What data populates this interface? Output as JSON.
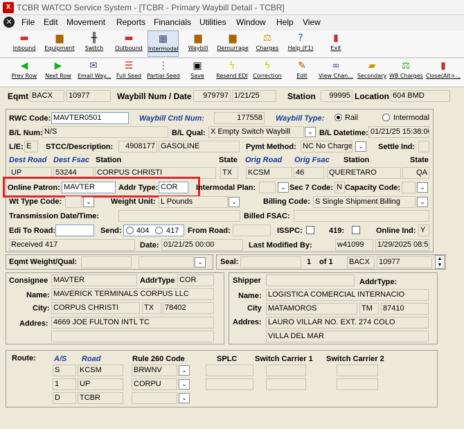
{
  "window": {
    "title": "TCBR WATCO Service System - [TCBR - Primary Waybill Detail - TCBR]",
    "app_icon": "X"
  },
  "menu": [
    "File",
    "Edit",
    "Movement",
    "Reports",
    "Financials",
    "Utilities",
    "Window",
    "Help",
    "View"
  ],
  "toolbar1": [
    "Inbound",
    "Equipment",
    "Switch",
    "Outbound",
    "Intermodal",
    "Waybill",
    "Demurrage",
    "Charges",
    "Help (F1)",
    "Exit"
  ],
  "toolbar2": [
    "Prev Row",
    "Next Row",
    "Email Way...",
    "Full Seed",
    "Partial Seed",
    "Save",
    "Resend EDI",
    "Correction",
    "Edit",
    "View Chan...",
    "Secondary",
    "WB Charges",
    "Close(Alt+..."
  ],
  "header": {
    "eqmt_label": "Eqmt",
    "eqmt_init": "BACX",
    "eqmt_num": "10977",
    "waybill_label": "Waybill Num / Date",
    "waybill_num": "979797",
    "waybill_date": "1/21/25",
    "station_label": "Station",
    "station_num": "99995",
    "location_label": "Location",
    "location": "604 BMD"
  },
  "form": {
    "rwc_label": "RWC Code:",
    "rwc": "MAVTER0501",
    "cntl_label": "Waybill Cntl Num:",
    "cntl": "177558",
    "type_label": "Waybill Type:",
    "rail": "Rail",
    "intermodal": "Intermodal",
    "bl_num_label": "B/L Num:",
    "bl_num": "N/S",
    "bl_qual_label": "B/L Qual:",
    "bl_qual": "X Empty Switch Waybill",
    "bl_dt_label": "B/L Datetime:",
    "bl_dt": "01/21/25 15:38:00",
    "le_label": "L/E:",
    "le": "E",
    "stcc_label": "STCC/Description:",
    "stcc": "4908177",
    "stcc_desc": "GASOLINE",
    "pymt_label": "Pymt Method:",
    "pymt": "NC No Charge",
    "settle_label": "Settle Ind:",
    "dest_road_label": "Dest Road",
    "dest_fsac_label": "Dest Fsac",
    "station_label": "Station",
    "state_label": "State",
    "orig_road_label": "Orig Road",
    "orig_fsac_label": "Orig Fsac",
    "station2_label": "Station",
    "state2_label": "State",
    "dest_road": "UP",
    "dest_fsac": "53244",
    "dest_station": "CORPUS CHRISTI",
    "dest_state": "TX",
    "orig_road": "KCSM",
    "orig_fsac": "46",
    "orig_station": "QUERETARO",
    "orig_state": "QA",
    "online_patron_label": "Online Patron:",
    "online_patron": "MAVTER",
    "addr_type_label": "Addr Type:",
    "addr_type": "COR",
    "intermodal_plan_label": "Intermodal Plan:",
    "sec7_label": "Sec 7 Code:",
    "sec7": "N",
    "capacity_label": "Capacity Code:",
    "wt_type_label": "Wt Type Code:",
    "weight_unit_label": "Weight Unit:",
    "weight_unit": "L Pounds",
    "billing_label": "Billing Code:",
    "billing": "S Single Shipment Billing",
    "trans_label": "Transmission Date/Time:",
    "billed_fsac_label": "Billed FSAC:",
    "edi_label": "Edi To Road:",
    "send_label": "Send:",
    "send_404": "404",
    "send_417": "417",
    "from_road_label": "From Road:",
    "isspc_label": "ISSPC:",
    "r419_label": "419:",
    "online_ind_label": "Online Ind:",
    "online_ind": "Y",
    "received": "Received 417",
    "date_label": "Date:",
    "date": "01/21/25 00:00",
    "last_mod_label": "Last Modified By:",
    "last_mod_user": "w41099",
    "last_mod_date": "1/29/2025 08:56:09"
  },
  "eqmt_weight": {
    "label": "Eqmt Weight/Qual:"
  },
  "seal": {
    "label": "Seal:",
    "page": "1",
    "of": "of 1",
    "init": "BACX",
    "num": "10977"
  },
  "consignee": {
    "label": "Consignee",
    "code": "MAVTER",
    "addr_type_label": "AddrType",
    "addr_type": "COR",
    "name_label": "Name:",
    "name": "MAVERICK TERMINALS CORPUS LLC",
    "city_label": "City:",
    "city": "CORPUS CHRISTI",
    "state": "TX",
    "zip": "78402",
    "address_label": "Addres:",
    "address": "4669 JOE FULTON INTL TC"
  },
  "shipper": {
    "label": "Shipper",
    "addr_type_label": "AddrType:",
    "name_label": "Name:",
    "name": "LOGISTICA COMERCIAL INTERNACIO",
    "city_label": "City",
    "city": "MATAMOROS",
    "state": "TM",
    "zip": "87410",
    "address_label": "Addres:",
    "address": "LAURO VILLAR NO. EXT. 274 COLO",
    "address2": "VILLA DEL MAR"
  },
  "route": {
    "label": "Route:",
    "as_label": "A/S",
    "road_label": "Road",
    "rule_label": "Rule 260 Code",
    "splc_label": "SPLC",
    "sw1_label": "Switch Carrier 1",
    "sw2_label": "Switch Carrier 2",
    "rows": [
      {
        "as": "S",
        "road": "KCSM",
        "rule": "BRWNV"
      },
      {
        "as": "1",
        "road": "UP",
        "rule": "CORPU"
      },
      {
        "as": "D",
        "road": "TCBR",
        "rule": ""
      }
    ]
  }
}
